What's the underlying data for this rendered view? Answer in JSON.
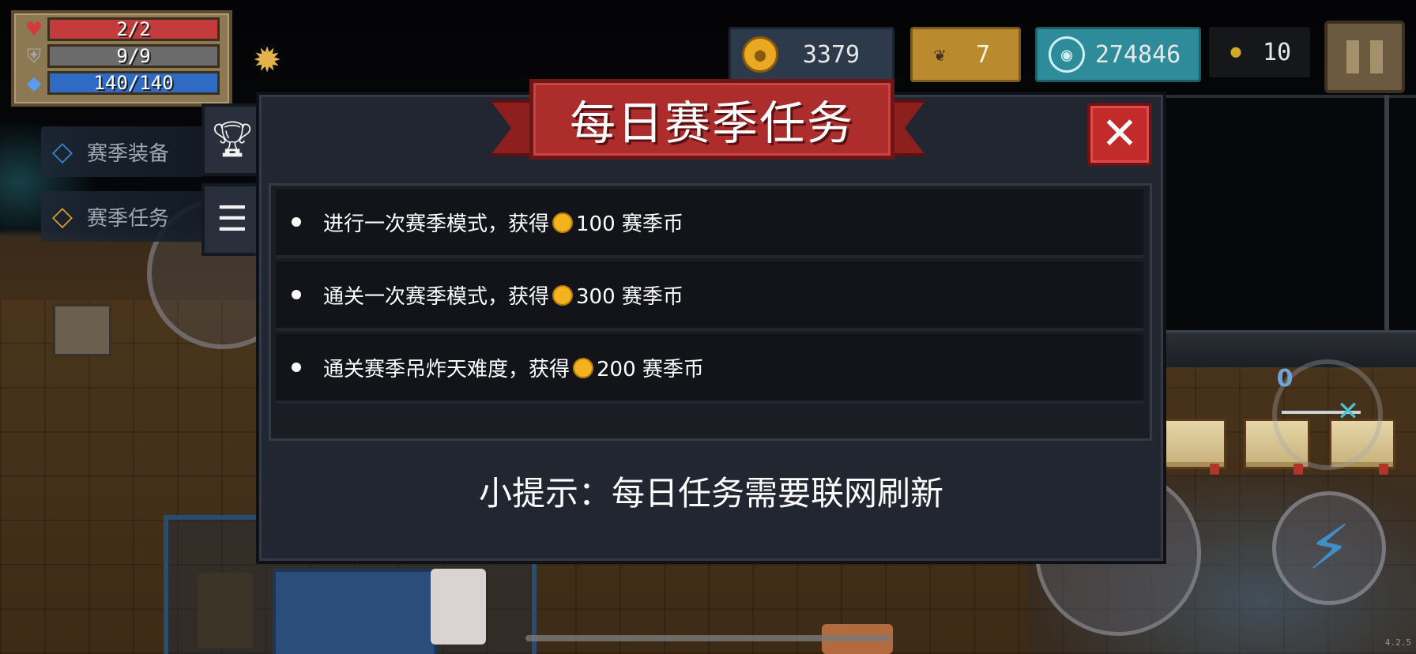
{
  "hud": {
    "hp": {
      "value": "2/2",
      "fill": 1.0,
      "color": "#c43b3b",
      "icon": "heart-icon"
    },
    "armor": {
      "value": "9/9",
      "fill": 1.0,
      "color": "#6b6b6b",
      "icon": "shield-icon"
    },
    "energy": {
      "value": "140/140",
      "fill": 1.0,
      "color": "#2f6bc4",
      "icon": "energy-crystal-icon"
    },
    "buff_icon": "buff-icon",
    "currencies": {
      "coins": {
        "value": "3379",
        "icon": "coin-icon"
      },
      "fish": {
        "value": "7",
        "icon": "fish-icon"
      },
      "gems": {
        "value": "274846",
        "icon": "gem-icon"
      },
      "seeds": {
        "value": "10",
        "icon": "seed-icon"
      }
    },
    "pause_icon": "pause-icon"
  },
  "side_menu": {
    "items": [
      {
        "label": "赛季装备",
        "icon": "diamond-icon"
      },
      {
        "label": "赛季任务",
        "icon": "diamond-icon"
      }
    ],
    "tabs": [
      {
        "icon": "trophy-icon"
      },
      {
        "icon": "list-icon"
      }
    ]
  },
  "dialog": {
    "title": "每日赛季任务",
    "close_icon": "close-icon",
    "tasks": [
      {
        "prefix": "进行一次赛季模式，获得",
        "amount": "100",
        "suffix": "赛季币"
      },
      {
        "prefix": "通关一次赛季模式，获得",
        "amount": "300",
        "suffix": "赛季币"
      },
      {
        "prefix": "通关赛季吊炸天难度，获得",
        "amount": "200",
        "suffix": "赛季币"
      }
    ],
    "tip": "小提示：每日任务需要联网刷新"
  },
  "weapon": {
    "cost": "0"
  },
  "version": "4.2.5",
  "colors": {
    "ribbon": "#ad2c2c",
    "close": "#c32b2b",
    "dialog_bg": "#222630",
    "coin": "#f2b31e"
  }
}
